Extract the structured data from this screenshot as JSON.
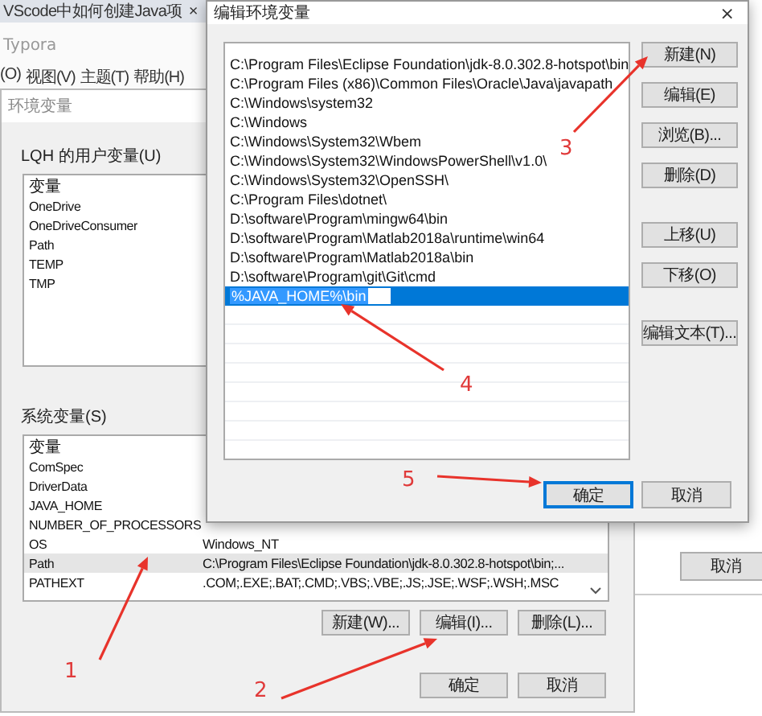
{
  "browser_tab": {
    "title": "VScode中如何创建Java项",
    "close": "×"
  },
  "typora": {
    "title": "Typora",
    "menu": [
      "(O)",
      "视图(V)",
      "主题(T)",
      "帮助(H)"
    ]
  },
  "env_dialog": {
    "title": "环境变量",
    "user_section": {
      "label": "LQH 的用户变量(U)",
      "column_1": "变量",
      "rows": [
        {
          "name": "OneDrive",
          "selected": false
        },
        {
          "name": "OneDriveConsumer",
          "selected": false
        },
        {
          "name": "Path",
          "selected": false
        },
        {
          "name": "TEMP",
          "selected": false
        },
        {
          "name": "TMP",
          "selected": false
        }
      ]
    },
    "system_section": {
      "label": "系统变量(S)",
      "column_1": "变量",
      "rows": [
        {
          "name": "ComSpec",
          "selected": false
        },
        {
          "name": "DriverData",
          "selected": false
        },
        {
          "name": "JAVA_HOME",
          "selected": false
        },
        {
          "name": "NUMBER_OF_PROCESSORS",
          "selected": false
        },
        {
          "name": "OS",
          "value": "Windows_NT",
          "selected": false
        },
        {
          "name": "Path",
          "value": "C:\\Program Files\\Eclipse Foundation\\jdk-8.0.302.8-hotspot\\bin;...",
          "selected": true
        },
        {
          "name": "PATHEXT",
          "value": ".COM;.EXE;.BAT;.CMD;.VBS;.VBE;.JS;.JSE;.WSF;.WSH;.MSC",
          "selected": false
        }
      ],
      "buttons": [
        "新建(W)...",
        "编辑(I)...",
        "删除(L)..."
      ]
    },
    "buttons": [
      "确定",
      "取消"
    ]
  },
  "back_window": {
    "buttons": [
      "取消"
    ]
  },
  "edit_dialog": {
    "title": "编辑环境变量",
    "close": "×",
    "entries": [
      {
        "text": "C:\\Program Files\\Eclipse Foundation\\jdk-8.0.302.8-hotspot\\bin",
        "selected": false
      },
      {
        "text": "C:\\Program Files (x86)\\Common Files\\Oracle\\Java\\javapath",
        "selected": false
      },
      {
        "text": "C:\\Windows\\system32",
        "selected": false
      },
      {
        "text": "C:\\Windows",
        "selected": false
      },
      {
        "text": "C:\\Windows\\System32\\Wbem",
        "selected": false
      },
      {
        "text": "C:\\Windows\\System32\\WindowsPowerShell\\v1.0\\",
        "selected": false
      },
      {
        "text": "C:\\Windows\\System32\\OpenSSH\\",
        "selected": false
      },
      {
        "text": "C:\\Program Files\\dotnet\\",
        "selected": false
      },
      {
        "text": "D:\\software\\Program\\mingw64\\bin",
        "selected": false
      },
      {
        "text": "D:\\software\\Program\\Matlab2018a\\runtime\\win64",
        "selected": false
      },
      {
        "text": "D:\\software\\Program\\Matlab2018a\\bin",
        "selected": false
      },
      {
        "text": "D:\\software\\Program\\git\\Git\\cmd",
        "selected": false
      },
      {
        "text": "%JAVA_HOME%\\bin",
        "selected": true
      }
    ],
    "side_buttons": [
      "新建(N)",
      "编辑(E)",
      "浏览(B)...",
      "删除(D)",
      "上移(U)",
      "下移(O)",
      "编辑文本(T)..."
    ],
    "footer_buttons": [
      {
        "label": "确定",
        "default": true
      },
      {
        "label": "取消",
        "default": false
      }
    ]
  },
  "annotations": [
    "1",
    "2",
    "3",
    "4",
    "5"
  ]
}
